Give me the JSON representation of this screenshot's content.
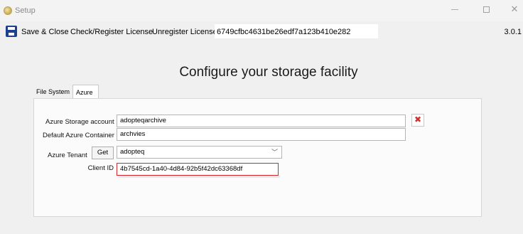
{
  "window": {
    "title": "Setup",
    "icon": "setup-app-icon"
  },
  "toolbar": {
    "save_close": "Save & Close",
    "check_register": "Check/Register License",
    "unregister": "Unregister License",
    "license_key": "6749cfbc4631be26edf7a123b410e282",
    "version": "3.0.1"
  },
  "heading": "Configure your storage facility",
  "tabs": [
    {
      "label": "File System",
      "selected": false
    },
    {
      "label": "Azure",
      "selected": true
    }
  ],
  "form": {
    "storage_account": {
      "label": "Azure Storage account",
      "value": "adopteqarchive"
    },
    "default_container": {
      "label": "Default Azure Container",
      "value": "archvies"
    },
    "tenant": {
      "label": "Azure Tenant",
      "get_label": "Get",
      "value": "adopteq"
    },
    "client_id": {
      "label": "Client ID",
      "value": "4b7545cd-1a40-4d84-92b5f42dc63368df"
    }
  },
  "colors": {
    "highlight": "#d7262e",
    "clear_icon": "#d03030",
    "save_icon": "#1f3f8f"
  }
}
